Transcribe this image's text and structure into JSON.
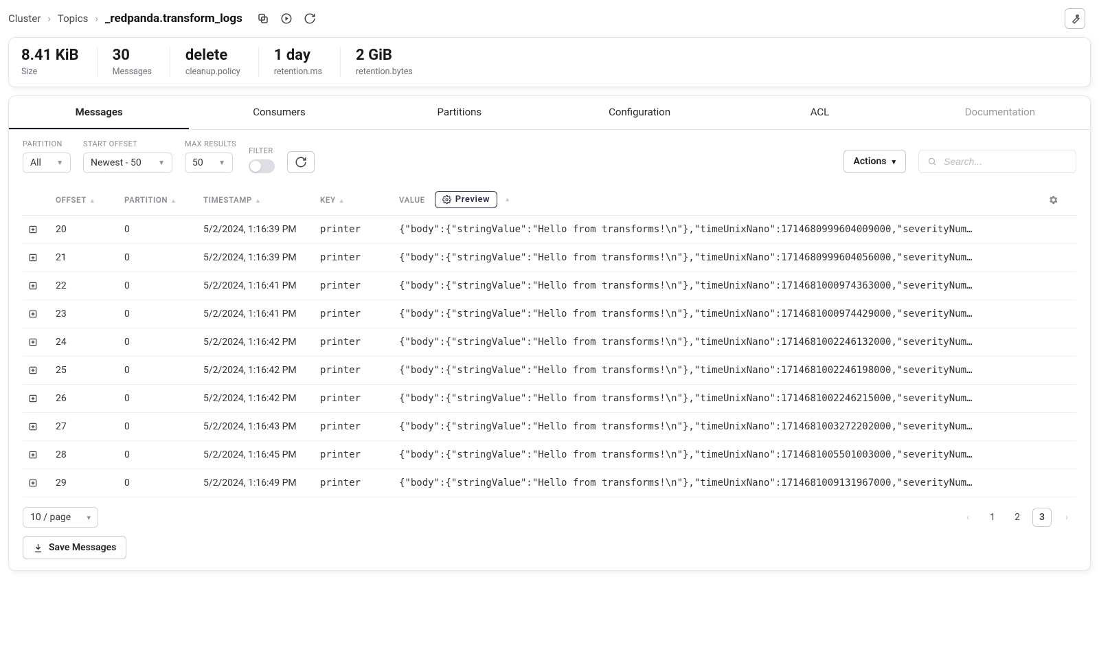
{
  "breadcrumb": {
    "items": [
      "Cluster",
      "Topics"
    ],
    "current": "_redpanda.transform_logs"
  },
  "stats": [
    {
      "value": "8.41 KiB",
      "label": "Size"
    },
    {
      "value": "30",
      "label": "Messages"
    },
    {
      "value": "delete",
      "label": "cleanup.policy"
    },
    {
      "value": "1 day",
      "label": "retention.ms"
    },
    {
      "value": "2 GiB",
      "label": "retention.bytes"
    }
  ],
  "tabs": [
    "Messages",
    "Consumers",
    "Partitions",
    "Configuration",
    "ACL",
    "Documentation"
  ],
  "controls": {
    "partition_label": "PARTITION",
    "partition_value": "All",
    "start_label": "START OFFSET",
    "start_value": "Newest - 50",
    "max_label": "MAX RESULTS",
    "max_value": "50",
    "filter_label": "FILTER",
    "actions_label": "Actions",
    "search_placeholder": "Search..."
  },
  "columns": {
    "offset": "OFFSET",
    "partition": "PARTITION",
    "timestamp": "TIMESTAMP",
    "key": "KEY",
    "value": "VALUE",
    "preview_btn": "Preview"
  },
  "rows": [
    {
      "offset": "20",
      "partition": "0",
      "timestamp": "5/2/2024, 1:16:39 PM",
      "key": "printer",
      "value": "{\"body\":{\"stringValue\":\"Hello from transforms!\\n\"},\"timeUnixNano\":1714680999604009000,\"severityNum…"
    },
    {
      "offset": "21",
      "partition": "0",
      "timestamp": "5/2/2024, 1:16:39 PM",
      "key": "printer",
      "value": "{\"body\":{\"stringValue\":\"Hello from transforms!\\n\"},\"timeUnixNano\":1714680999604056000,\"severityNum…"
    },
    {
      "offset": "22",
      "partition": "0",
      "timestamp": "5/2/2024, 1:16:41 PM",
      "key": "printer",
      "value": "{\"body\":{\"stringValue\":\"Hello from transforms!\\n\"},\"timeUnixNano\":1714681000974363000,\"severityNum…"
    },
    {
      "offset": "23",
      "partition": "0",
      "timestamp": "5/2/2024, 1:16:41 PM",
      "key": "printer",
      "value": "{\"body\":{\"stringValue\":\"Hello from transforms!\\n\"},\"timeUnixNano\":1714681000974429000,\"severityNum…"
    },
    {
      "offset": "24",
      "partition": "0",
      "timestamp": "5/2/2024, 1:16:42 PM",
      "key": "printer",
      "value": "{\"body\":{\"stringValue\":\"Hello from transforms!\\n\"},\"timeUnixNano\":1714681002246132000,\"severityNum…"
    },
    {
      "offset": "25",
      "partition": "0",
      "timestamp": "5/2/2024, 1:16:42 PM",
      "key": "printer",
      "value": "{\"body\":{\"stringValue\":\"Hello from transforms!\\n\"},\"timeUnixNano\":1714681002246198000,\"severityNum…"
    },
    {
      "offset": "26",
      "partition": "0",
      "timestamp": "5/2/2024, 1:16:42 PM",
      "key": "printer",
      "value": "{\"body\":{\"stringValue\":\"Hello from transforms!\\n\"},\"timeUnixNano\":1714681002246215000,\"severityNum…"
    },
    {
      "offset": "27",
      "partition": "0",
      "timestamp": "5/2/2024, 1:16:43 PM",
      "key": "printer",
      "value": "{\"body\":{\"stringValue\":\"Hello from transforms!\\n\"},\"timeUnixNano\":1714681003272202000,\"severityNum…"
    },
    {
      "offset": "28",
      "partition": "0",
      "timestamp": "5/2/2024, 1:16:45 PM",
      "key": "printer",
      "value": "{\"body\":{\"stringValue\":\"Hello from transforms!\\n\"},\"timeUnixNano\":1714681005501003000,\"severityNum…"
    },
    {
      "offset": "29",
      "partition": "0",
      "timestamp": "5/2/2024, 1:16:49 PM",
      "key": "printer",
      "value": "{\"body\":{\"stringValue\":\"Hello from transforms!\\n\"},\"timeUnixNano\":1714681009131967000,\"severityNum…"
    }
  ],
  "footer": {
    "page_size": "10 / page",
    "pages": [
      "1",
      "2",
      "3"
    ],
    "current_page": "3",
    "save_label": "Save Messages"
  }
}
